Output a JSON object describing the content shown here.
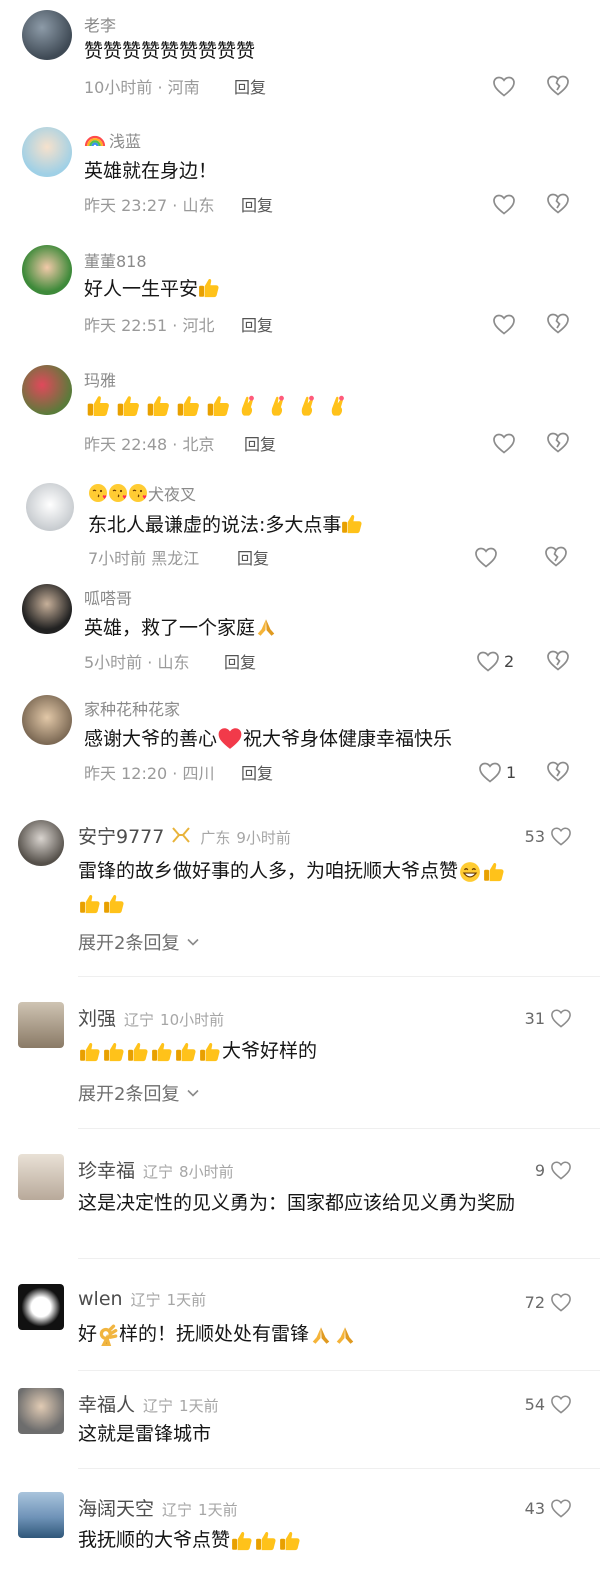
{
  "comments_top": [
    {
      "name": "老李",
      "text": "赞赞赞赞赞赞赞赞赞",
      "time": "10小时前",
      "loc": "河南",
      "reply": "回复"
    },
    {
      "name": "浅蓝",
      "text": "英雄就在身边！",
      "time": "昨天 23:27",
      "loc": "山东",
      "reply": "回复"
    },
    {
      "name": "董董818",
      "text": "好人一生平安",
      "time": "昨天 22:51",
      "loc": "河北",
      "reply": "回复"
    },
    {
      "name": "玛雅",
      "text": "",
      "time": "昨天 22:48",
      "loc": "北京",
      "reply": "回复"
    },
    {
      "name": "犬夜叉",
      "text": "东北人最谦虚的说法:多大点事",
      "time": "7小时前",
      "loc": "黑龙江",
      "reply": "回复"
    },
    {
      "name": "呱嗒哥",
      "text": "英雄，救了一个家庭",
      "time": "5小时前",
      "loc": "山东",
      "reply": "回复",
      "likes": "2"
    },
    {
      "name": "家种花种花家",
      "text_a": "感谢大爷的善心",
      "text_b": "祝大爷身体健康幸福快乐",
      "time": "昨天 12:20",
      "loc": "四川",
      "reply": "回复",
      "likes": "1"
    }
  ],
  "comments_bottom": [
    {
      "name": "安宁9777",
      "loc": "广东",
      "time": "9小时前",
      "likes": "53",
      "text": "雷锋的故乡做好事的人多，为咱抚顺大爷点赞",
      "expand": "展开2条回复"
    },
    {
      "name": "刘强",
      "loc": "辽宁",
      "time": "10小时前",
      "likes": "31",
      "text": "大爷好样的",
      "expand": "展开2条回复"
    },
    {
      "name": "珍幸福",
      "loc": "辽宁",
      "time": "8小时前",
      "likes": "9",
      "text": "这是决定性的见义勇为：国家都应该给见义勇为奖励"
    },
    {
      "name": "wlen",
      "loc": "辽宁",
      "time": "1天前",
      "likes": "72",
      "text_a": "好",
      "text_b": "样的！抚顺处处有雷锋"
    },
    {
      "name": "幸福人",
      "loc": "辽宁",
      "time": "1天前",
      "likes": "54",
      "text": "这就是雷锋城市"
    },
    {
      "name": "海阔天空",
      "loc": "辽宁",
      "time": "1天前",
      "likes": "43",
      "text": "我抚顺的大爷点赞"
    }
  ],
  "separator": "·"
}
